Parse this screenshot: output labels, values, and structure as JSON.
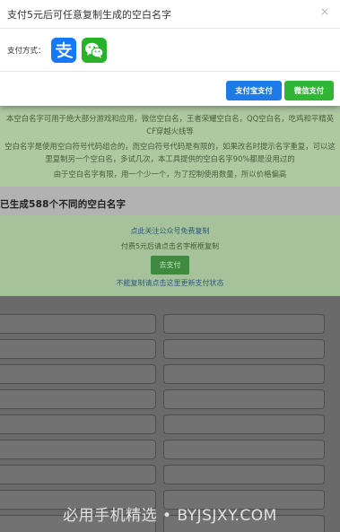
{
  "modal": {
    "title": "支付5元后可任意复制生成的空白名字",
    "close": "×",
    "pay_method_label": "支付方式：",
    "alipay_icon": "alipay-icon",
    "wechat_icon": "wechat-pay-icon",
    "alipay_button": "支付宝支付",
    "wechat_button": "微信支付"
  },
  "background": {
    "intro_1": "本空白名字可用于绝大部分游戏和应用，微信空白名，王者荣耀空白名，QQ空白名，吃鸡和平精英CF穿越火线等",
    "intro_2": "空白名字是使用空白符号代码组合的，而空白符号代码是有限的，如果改名时提示名字重复，可以这里复制另一个空白名，多试几次，本工具提供的空白名字90%都是没用过的",
    "intro_3": "由于空白名字有限，用一个少一个，为了控制使用数量，所以价格偏高",
    "count_text": "已生成588个不同的空白名字",
    "follow_link": "点此关注公众号免费复制",
    "after_pay_hint": "付费5元后请点击名字框框复制",
    "go_pay_button": "去支付",
    "refresh_link": "不能复制请点击这里更新支付状态",
    "watermark": "必用手机精选 • BYJSJXY.COM"
  },
  "colors": {
    "alipay_blue": "#1e7be6",
    "wechat_green": "#31b534"
  }
}
